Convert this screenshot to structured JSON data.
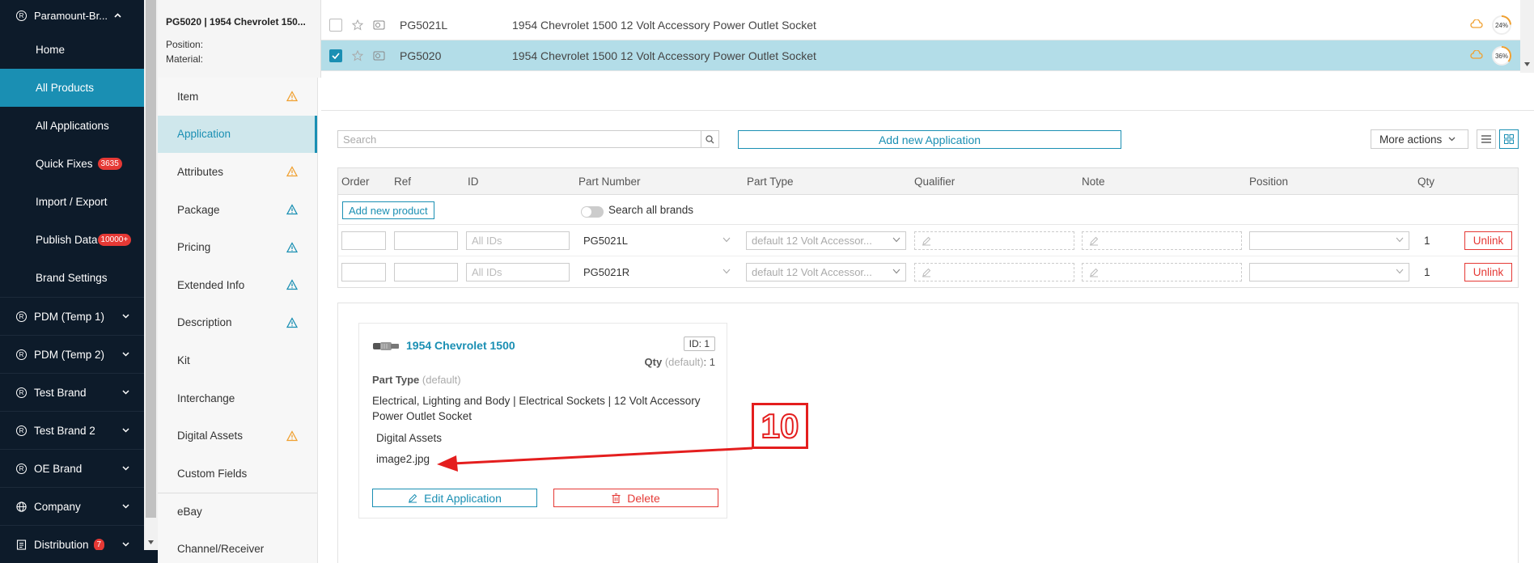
{
  "nav": {
    "brand": "Paramount-Br...",
    "items": [
      {
        "label": "Home"
      },
      {
        "label": "All Products",
        "active": true
      },
      {
        "label": "All Applications"
      },
      {
        "label": "Quick Fixes",
        "badge": "3635"
      },
      {
        "label": "Import / Export"
      },
      {
        "label": "Publish Data",
        "badge": "10000+"
      },
      {
        "label": "Brand Settings"
      }
    ],
    "groups": [
      {
        "label": "PDM (Temp 1)"
      },
      {
        "label": "PDM (Temp 2)"
      },
      {
        "label": "Test Brand"
      },
      {
        "label": "Test Brand 2"
      },
      {
        "label": "OE Brand"
      },
      {
        "label": "Company"
      },
      {
        "label": "Distribution",
        "badge": "7"
      }
    ]
  },
  "product_side": {
    "title": "PG5020 | 1954 Chevrolet 150...",
    "position_label": "Position:",
    "material_label": "Material:"
  },
  "list": {
    "rows": [
      {
        "sku": "PG5021L",
        "desc": "1954 Chevrolet 1500 12 Volt Accessory Power Outlet Socket",
        "progress": "24%",
        "checked": false
      },
      {
        "sku": "PG5020",
        "desc": "1954 Chevrolet 1500 12 Volt Accessory Power Outlet Socket",
        "progress": "36%",
        "checked": true
      }
    ]
  },
  "tabs": [
    {
      "label": "Item",
      "warn": "orange"
    },
    {
      "label": "Application",
      "active": true
    },
    {
      "label": "Attributes",
      "warn": "orange"
    },
    {
      "label": "Package",
      "warn": "blue"
    },
    {
      "label": "Pricing",
      "warn": "blue"
    },
    {
      "label": "Extended Info",
      "warn": "blue"
    },
    {
      "label": "Description",
      "warn": "blue"
    },
    {
      "label": "Kit"
    },
    {
      "label": "Interchange"
    },
    {
      "label": "Digital Assets",
      "warn": "orange"
    },
    {
      "label": "Custom Fields"
    },
    {
      "label": "eBay"
    },
    {
      "label": "Channel/Receiver"
    }
  ],
  "toolbar": {
    "search_placeholder": "Search",
    "add_application_label": "Add new Application",
    "more_actions_label": "More actions"
  },
  "table": {
    "headers": [
      "Order",
      "Ref",
      "ID",
      "Part Number",
      "Part Type",
      "Qualifier",
      "Note",
      "Position",
      "Qty"
    ],
    "add_product_label": "Add new product",
    "search_all_brands_label": "Search all brands",
    "id_placeholder": "All IDs",
    "unlink_label": "Unlink",
    "rows": [
      {
        "part_number": "PG5021L",
        "part_type": "default 12 Volt Accessor...",
        "qty": "1"
      },
      {
        "part_number": "PG5021R",
        "part_type": "default 12 Volt Accessor...",
        "qty": "1"
      }
    ]
  },
  "card": {
    "title": "1954 Chevrolet 1500",
    "id_badge": "ID: 1",
    "qty_label": "Qty",
    "qty_default": "(default)",
    "qty_value": ": 1",
    "part_type_label": "Part Type",
    "part_type_default": "(default)",
    "part_type_value": "Electrical, Lighting and Body | Electrical Sockets | 12 Volt Accessory Power Outlet Socket",
    "digital_assets_label": "Digital Assets",
    "digital_asset_file": "image2.jpg",
    "edit_label": "Edit Application",
    "delete_label": "Delete"
  },
  "annotation": {
    "step_number": "10"
  },
  "colors": {
    "nav_bg": "#0d1b2a",
    "accent": "#1a8fb3",
    "danger": "#e53935",
    "warn_orange": "#f0a030",
    "warn_blue": "#1a8fb3",
    "annotation_red": "#e41e1e"
  }
}
